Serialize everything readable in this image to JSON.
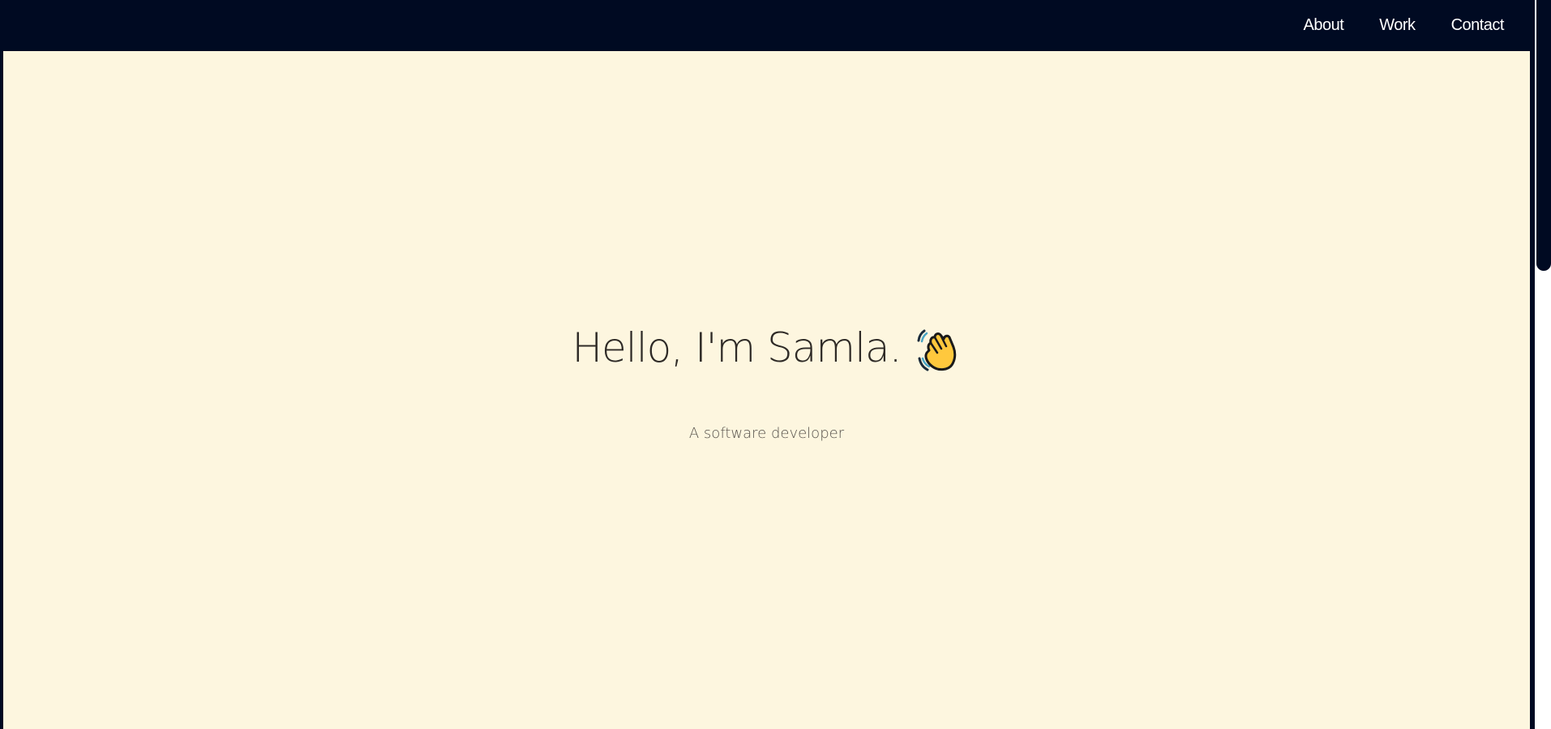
{
  "nav": {
    "items": [
      {
        "label": "About"
      },
      {
        "label": "Work"
      },
      {
        "label": "Contact"
      }
    ]
  },
  "hero": {
    "title": "Hello, I'm Samla.",
    "title_icon": "waving-hand-icon",
    "subtitle": "A software developer"
  },
  "colors": {
    "navbar_bg": "#000a22",
    "hero_bg": "#fdf6df",
    "title_text": "#2e2a26",
    "subtitle_text": "#55504a",
    "nav_text": "#ffffff"
  }
}
